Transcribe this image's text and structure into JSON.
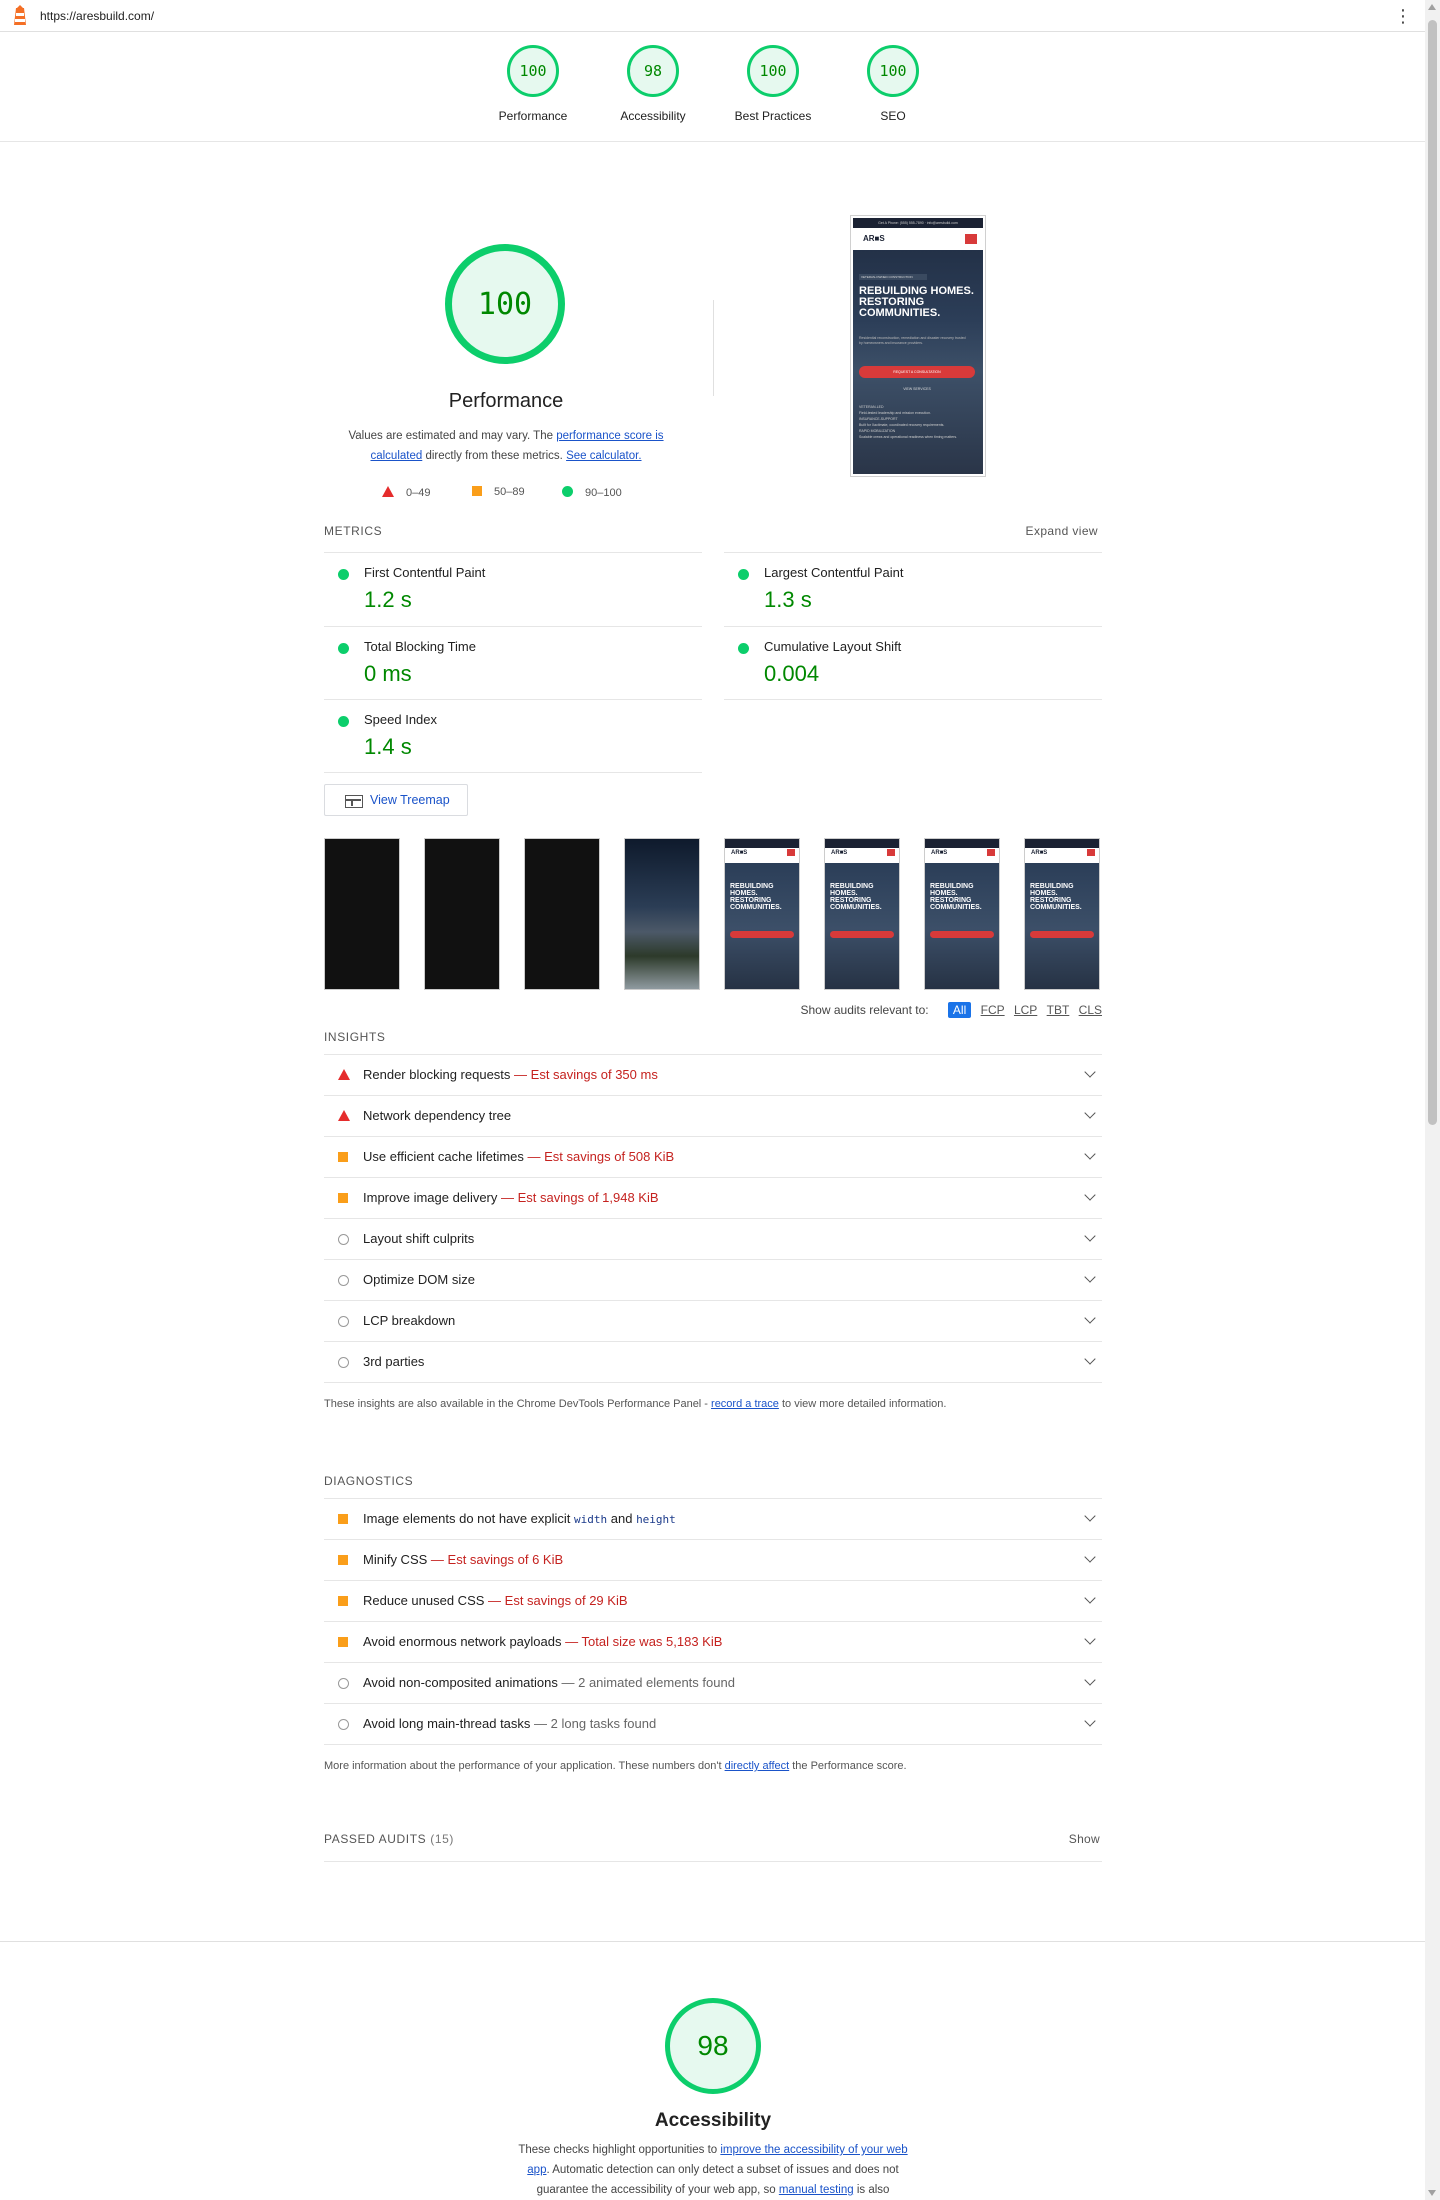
{
  "url": "https://aresbuild.com/",
  "gauges": [
    {
      "score": "100",
      "label": "Performance"
    },
    {
      "score": "98",
      "label": "Accessibility"
    },
    {
      "score": "100",
      "label": "Best Practices"
    },
    {
      "score": "100",
      "label": "SEO"
    }
  ],
  "performance": {
    "score": "100",
    "title": "Performance",
    "desc_1": "Values are estimated and may vary. The ",
    "desc_link_1": "performance score is calculated",
    "desc_2": " directly from these metrics. ",
    "desc_link_2": "See calculator.",
    "legend": [
      "0–49",
      "50–89",
      "90–100"
    ]
  },
  "preview": {
    "topbar": "Get A Phone: (555) 555-7890 · info@aresbuild.com",
    "logo": "AR■S",
    "tag": "VETERAN-OWNED CONSTRUCTION",
    "headline": "REBUILDING HOMES. RESTORING COMMUNITIES.",
    "sub": "Residential reconstruction, remediation and disaster recovery trusted by homeowners and insurance providers.",
    "cta": "REQUEST A CONSULTATION",
    "view": "VIEW SERVICES",
    "list": [
      "VETERAN-LED",
      "Field-tested leadership and mission execution.",
      "INSURANCE-SUPPORT",
      "Built for Xactimate, coordinated recovery requirements.",
      "RAPID MOBILIZATION",
      "Scalable crews and operational readiness when timing matters."
    ]
  },
  "metrics": {
    "header": "METRICS",
    "expand": "Expand view",
    "items": [
      {
        "name": "First Contentful Paint",
        "value": "1.2 s"
      },
      {
        "name": "Largest Contentful Paint",
        "value": "1.3 s"
      },
      {
        "name": "Total Blocking Time",
        "value": "0 ms"
      },
      {
        "name": "Cumulative Layout Shift",
        "value": "0.004"
      },
      {
        "name": "Speed Index",
        "value": "1.4 s"
      }
    ]
  },
  "treemap_label": "View Treemap",
  "filmstrip": {
    "frame_text": "REBUILDING HOMES. RESTORING COMMUNITIES.",
    "frame_logo": "AR■S"
  },
  "relevant": {
    "label": "Show audits relevant to:",
    "chips": [
      "All",
      "FCP",
      "LCP",
      "TBT",
      "CLS"
    ]
  },
  "insights": {
    "header": "INSIGHTS",
    "items": [
      {
        "name": "Render blocking requests",
        "savings": "— Est savings of 350 ms"
      },
      {
        "name": "Network dependency tree",
        "savings": ""
      },
      {
        "name": "Use efficient cache lifetimes",
        "savings": "— Est savings of 508 KiB"
      },
      {
        "name": "Improve image delivery",
        "savings": "— Est savings of 1,948 KiB"
      },
      {
        "name": "Layout shift culprits",
        "savings": ""
      },
      {
        "name": "Optimize DOM size",
        "savings": ""
      },
      {
        "name": "LCP breakdown",
        "savings": ""
      },
      {
        "name": "3rd parties",
        "savings": ""
      }
    ],
    "note_1": "These insights are also available in the Chrome DevTools Performance Panel - ",
    "note_link": "record a trace",
    "note_2": " to view more detailed information."
  },
  "diagnostics": {
    "header": "DIAGNOSTICS",
    "img_1": "Image elements do not have explicit ",
    "img_code_1": "width",
    "img_2": " and ",
    "img_code_2": "height",
    "items": [
      {
        "name": "Minify CSS",
        "savings": "— Est savings of 6 KiB"
      },
      {
        "name": "Reduce unused CSS",
        "savings": "— Est savings of 29 KiB"
      },
      {
        "name": "Avoid enormous network payloads",
        "savings": "— Total size was 5,183 KiB"
      },
      {
        "name": "Avoid non-composited animations",
        "savings": "— 2 animated elements found"
      },
      {
        "name": "Avoid long main-thread tasks",
        "savings": "— 2 long tasks found"
      }
    ],
    "note_1": "More information about the performance of your application. These numbers don't ",
    "note_link": "directly affect",
    "note_2": " the Performance score."
  },
  "passed": {
    "label": "PASSED AUDITS",
    "count": "(15)",
    "show": "Show"
  },
  "accessibility": {
    "score": "98",
    "title": "Accessibility",
    "desc_1": "These checks highlight opportunities to ",
    "desc_link_1": "improve the accessibility of your web app",
    "desc_2": ". Automatic detection can only detect a subset of issues and does not guarantee the accessibility of your web app, so ",
    "desc_link_2": "manual testing",
    "desc_3": " is also"
  },
  "colors": {
    "pass": "#0cce6b",
    "pass_text": "#008800",
    "average": "#fa9e1a",
    "fail": "#e52c2c",
    "link": "#1a53c9"
  }
}
